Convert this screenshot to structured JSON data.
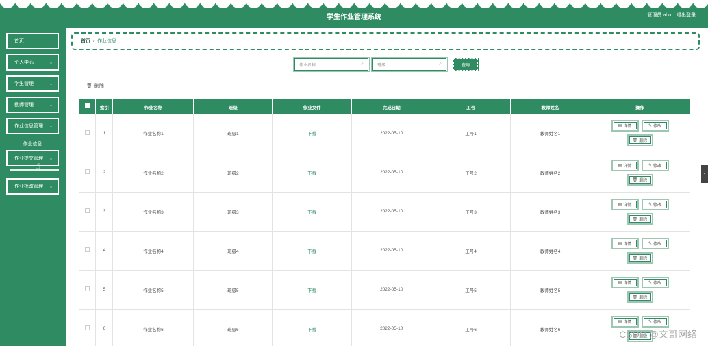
{
  "header": {
    "title": "学生作业管理系统",
    "user": "管理员 abo",
    "logout": "退出登录"
  },
  "sidebar": {
    "items": [
      {
        "label": "首页",
        "chevron": false
      },
      {
        "label": "个人中心",
        "chevron": true
      },
      {
        "label": "学生管理",
        "chevron": true
      },
      {
        "label": "教师管理",
        "chevron": true
      },
      {
        "label": "作业信息管理",
        "chevron": true
      },
      {
        "label": "作业提交管理",
        "chevron": true
      },
      {
        "label": "作业批改管理",
        "chevron": true
      }
    ],
    "sub_item": "作业信息"
  },
  "breadcrumb": {
    "home": "首页",
    "separator": "/",
    "current": "作业信息"
  },
  "search": {
    "name_placeholder": "作业名称",
    "class_placeholder": "班级",
    "query_label": "查询"
  },
  "toolbar": {
    "delete_label": "删除"
  },
  "table": {
    "columns": [
      "索引",
      "作业名称",
      "班级",
      "作业文件",
      "完成日期",
      "工号",
      "教师姓名",
      "操作"
    ],
    "rows": [
      {
        "index": "1",
        "name": "作业名称1",
        "class": "班级1",
        "file": "下载",
        "date": "2022-05-10",
        "id": "工号1",
        "teacher": "教师姓名1"
      },
      {
        "index": "2",
        "name": "作业名称2",
        "class": "班级2",
        "file": "下载",
        "date": "2022-05-10",
        "id": "工号2",
        "teacher": "教师姓名2"
      },
      {
        "index": "3",
        "name": "作业名称3",
        "class": "班级3",
        "file": "下载",
        "date": "2022-05-10",
        "id": "工号3",
        "teacher": "教师姓名3"
      },
      {
        "index": "4",
        "name": "作业名称4",
        "class": "班级4",
        "file": "下载",
        "date": "2022-05-10",
        "id": "工号4",
        "teacher": "教师姓名4"
      },
      {
        "index": "5",
        "name": "作业名称5",
        "class": "班级5",
        "file": "下载",
        "date": "2022-05-10",
        "id": "工号5",
        "teacher": "教师姓名5"
      },
      {
        "index": "6",
        "name": "作业名称6",
        "class": "班级6",
        "file": "下载",
        "date": "2022-05-10",
        "id": "工号6",
        "teacher": "教师姓名6"
      }
    ],
    "actions": {
      "detail": "详情",
      "edit": "修改",
      "delete": "删除"
    }
  },
  "watermark": "CSDN @文哥网络",
  "colors": {
    "primary": "#2e8b62",
    "accent_light": "#9dc7b3"
  },
  "icons": {
    "search": "search-icon",
    "trash": "trash-icon",
    "detail": "document-icon",
    "edit": "pencil-icon"
  }
}
